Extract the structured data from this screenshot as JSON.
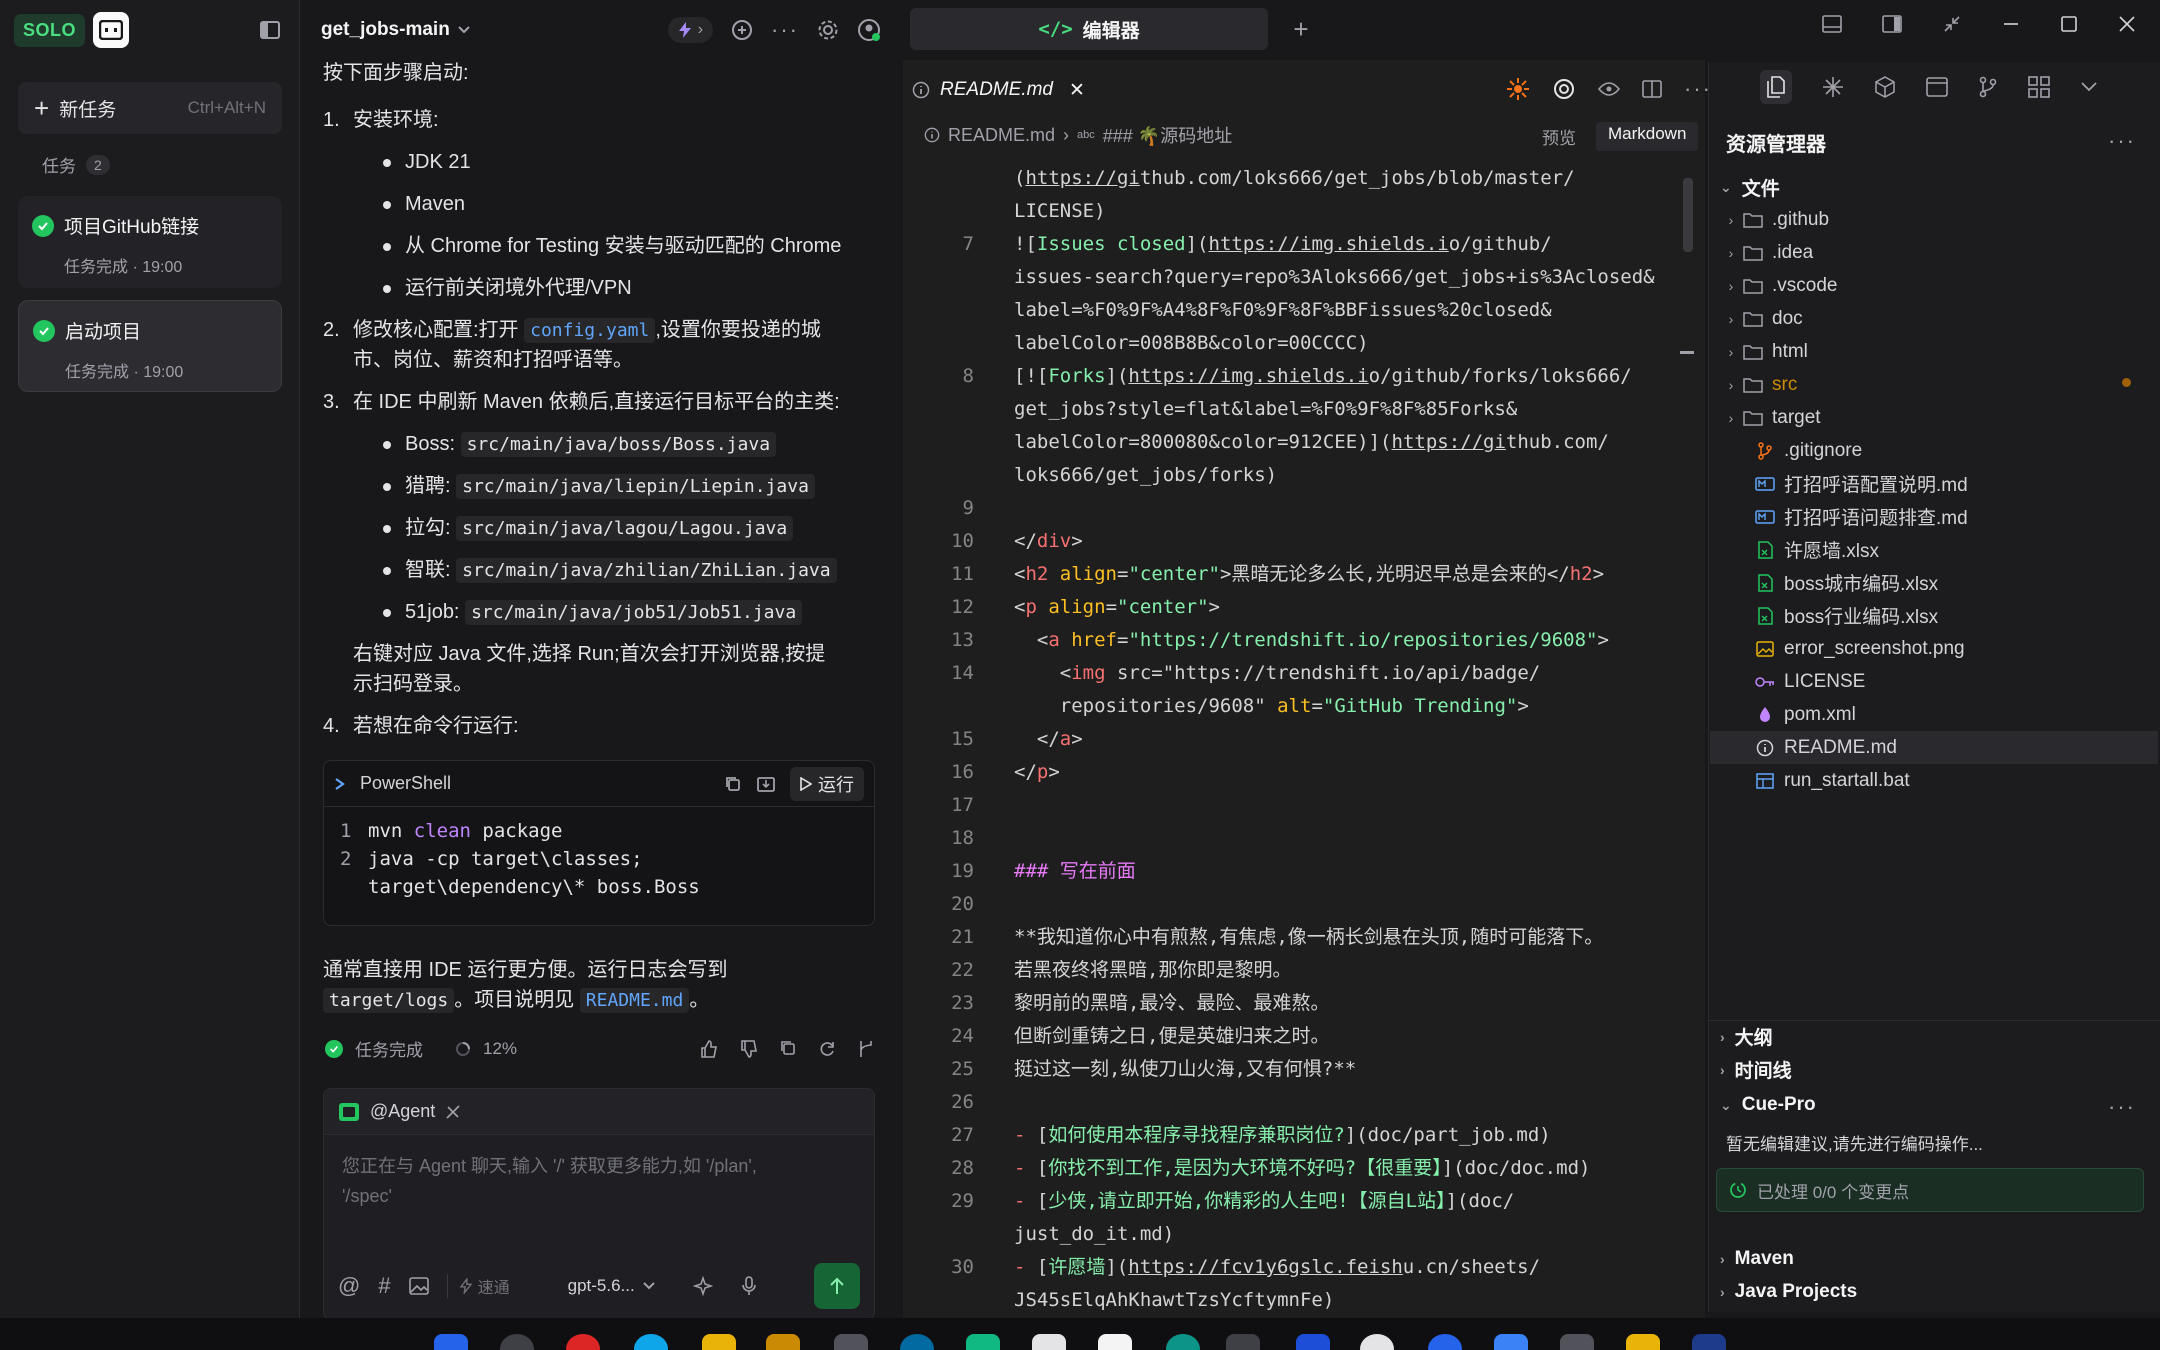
{
  "sidebar": {
    "logo_text": "SOLO",
    "new_task_label": "新任务",
    "new_task_shortcut": "Ctrl+Alt+N",
    "tasks_label": "任务",
    "tasks_count": "2",
    "tasks": [
      {
        "title": "项目GitHub链接",
        "status": "任务完成 · 19:00"
      },
      {
        "title": "启动项目",
        "status": "任务完成 · 19:00"
      }
    ]
  },
  "chat": {
    "project_name": "get_jobs-main",
    "intro": "按下面步骤启动:",
    "step1": "安装环境:",
    "step1_items": [
      "JDK 21",
      "Maven",
      "从 Chrome for Testing 安装与驱动匹配的 Chrome",
      "运行前关闭境外代理/VPN"
    ],
    "step2_a": "修改核心配置:打开 ",
    "step2_code": "config.yaml",
    "step2_b": ",设置你要投递的城",
    "step2_c": "市、岗位、薪资和打招呼语等。",
    "step3": "在 IDE 中刷新 Maven 依赖后,直接运行目标平台的主类:",
    "step3_items": [
      {
        "label": "Boss:",
        "code": "src/main/java/boss/Boss.java"
      },
      {
        "label": "猎聘:",
        "code": "src/main/java/liepin/Liepin.java"
      },
      {
        "label": "拉勾:",
        "code": "src/main/java/lagou/Lagou.java"
      },
      {
        "label": "智联:",
        "code": "src/main/java/zhilian/ZhiLian.java"
      },
      {
        "label": "51job:",
        "code": "src/main/java/job51/Job51.java"
      }
    ],
    "step3_note_1": "右键对应 Java 文件,选择 Run;首次会打开浏览器,按提",
    "step3_note_2": "示扫码登录。",
    "step4": "若想在命令行运行:",
    "code_lang": "PowerShell",
    "run_label": "运行",
    "code_lines": [
      {
        "num": "1",
        "pre": "mvn ",
        "kw": "clean",
        "post": " package"
      },
      {
        "num": "2",
        "pre": "java -cp target\\classes;",
        "kw": "",
        "post": ""
      },
      {
        "num": "",
        "pre": "target\\dependency\\* boss.Boss",
        "kw": "",
        "post": ""
      }
    ],
    "outro_1": "通常直接用 IDE 运行更方便。运行日志会写到",
    "outro_code1": "target/logs",
    "outro_mid": "。项目说明见 ",
    "outro_code2": "README.md",
    "outro_end": "。",
    "status": "任务完成",
    "progress": "12%",
    "agent_label": "@Agent",
    "input_placeholder_1": "您正在与 Agent 聊天,输入 '/' 获取更多能力,如 '/plan',",
    "input_placeholder_2": "'/spec'",
    "mode_label": "速通",
    "model_label": "gpt-5.6..."
  },
  "editor": {
    "window_tab": "编辑器",
    "file_tab": "README.md",
    "breadcrumb_file": "README.md",
    "breadcrumb_section": "### 🌴源码地址",
    "preview_label": "预览",
    "markdown_label": "Markdown",
    "lines": [
      {
        "n": "",
        "t": "(https://github.com/loks666/get_jobs/blob/master/"
      },
      {
        "n": "",
        "t": "LICENSE)"
      },
      {
        "n": "7",
        "t": "![Issues closed](https://img.shields.io/github/"
      },
      {
        "n": "",
        "t": "issues-search?query=repo%3Aloks666/get_jobs+is%3Aclosed&"
      },
      {
        "n": "",
        "t": "label=%F0%9F%A4%8F%F0%9F%8F%BBFissues%20closed&"
      },
      {
        "n": "",
        "t": "labelColor=008B8B&color=00CCCC)"
      },
      {
        "n": "8",
        "t": "[![Forks](https://img.shields.io/github/forks/loks666/"
      },
      {
        "n": "",
        "t": "get_jobs?style=flat&label=%F0%9F%8F%85Forks&"
      },
      {
        "n": "",
        "t": "labelColor=800080&color=912CEE)](https://github.com/"
      },
      {
        "n": "",
        "t": "loks666/get_jobs/forks)"
      },
      {
        "n": "9",
        "t": ""
      },
      {
        "n": "10",
        "t": "</div>"
      },
      {
        "n": "11",
        "t": "<h2 align=\"center\">黑暗无论多么长,光明迟早总是会来的</h2>"
      },
      {
        "n": "12",
        "t": "<p align=\"center\">"
      },
      {
        "n": "13",
        "t": "  <a href=\"https://trendshift.io/repositories/9608\">"
      },
      {
        "n": "14",
        "t": "    <img src=\"https://trendshift.io/api/badge/"
      },
      {
        "n": "",
        "t": "    repositories/9608\" alt=\"GitHub Trending\">"
      },
      {
        "n": "15",
        "t": "  </a>"
      },
      {
        "n": "16",
        "t": "</p>"
      },
      {
        "n": "17",
        "t": ""
      },
      {
        "n": "18",
        "t": ""
      },
      {
        "n": "19",
        "t": "### 写在前面"
      },
      {
        "n": "20",
        "t": ""
      },
      {
        "n": "21",
        "t": "**我知道你心中有煎熬,有焦虑,像一柄长剑悬在头顶,随时可能落下。"
      },
      {
        "n": "22",
        "t": "若黑夜终将黑暗,那你即是黎明。"
      },
      {
        "n": "23",
        "t": "黎明前的黑暗,最冷、最险、最难熬。"
      },
      {
        "n": "24",
        "t": "但断剑重铸之日,便是英雄归来之时。"
      },
      {
        "n": "25",
        "t": "挺过这一刻,纵使刀山火海,又有何惧?**"
      },
      {
        "n": "26",
        "t": ""
      },
      {
        "n": "27",
        "t": "- [如何使用本程序寻找程序兼职岗位?](doc/part_job.md)"
      },
      {
        "n": "28",
        "t": "- [你找不到工作,是因为大环境不好吗?【很重要】](doc/doc.md)"
      },
      {
        "n": "29",
        "t": "- [少侠,请立即开始,你精彩的人生吧!【源自L站】](doc/"
      },
      {
        "n": "",
        "t": "just_do_it.md)"
      },
      {
        "n": "30",
        "t": "- [许愿墙](https://fcv1y6gslc.feishu.cn/sheets/"
      },
      {
        "n": "",
        "t": "JS45sElqAhKhawtTzsYcftymnFe)"
      }
    ]
  },
  "explorer": {
    "title": "资源管理器",
    "root": "文件",
    "items": [
      {
        "name": ".github",
        "type": "folder"
      },
      {
        "name": ".idea",
        "type": "folder"
      },
      {
        "name": ".vscode",
        "type": "folder"
      },
      {
        "name": "doc",
        "type": "folder"
      },
      {
        "name": "html",
        "type": "folder"
      },
      {
        "name": "src",
        "type": "folder"
      },
      {
        "name": "target",
        "type": "folder"
      },
      {
        "name": ".gitignore",
        "type": "git"
      },
      {
        "name": "打招呼语配置说明.md",
        "type": "md"
      },
      {
        "name": "打招呼语问题排查.md",
        "type": "md"
      },
      {
        "name": "许愿墙.xlsx",
        "type": "xlsx"
      },
      {
        "name": "boss城市编码.xlsx",
        "type": "xlsx"
      },
      {
        "name": "boss行业编码.xlsx",
        "type": "xlsx"
      },
      {
        "name": "error_screenshot.png",
        "type": "png"
      },
      {
        "name": "LICENSE",
        "type": "license"
      },
      {
        "name": "pom.xml",
        "type": "xml"
      },
      {
        "name": "README.md",
        "type": "info"
      },
      {
        "name": "run_startall.bat",
        "type": "bat"
      }
    ],
    "outline": "大纲",
    "timeline": "时间线",
    "cue_title": "Cue-Pro",
    "cue_empty": "暂无编辑建议,请先进行编码操作...",
    "cue_status": "已处理 0/0 个变更点",
    "maven": "Maven",
    "java_projects": "Java Projects"
  },
  "colors": {
    "accent": "#22c55e",
    "link": "#60a5fa",
    "keyword": "#c084fc"
  }
}
